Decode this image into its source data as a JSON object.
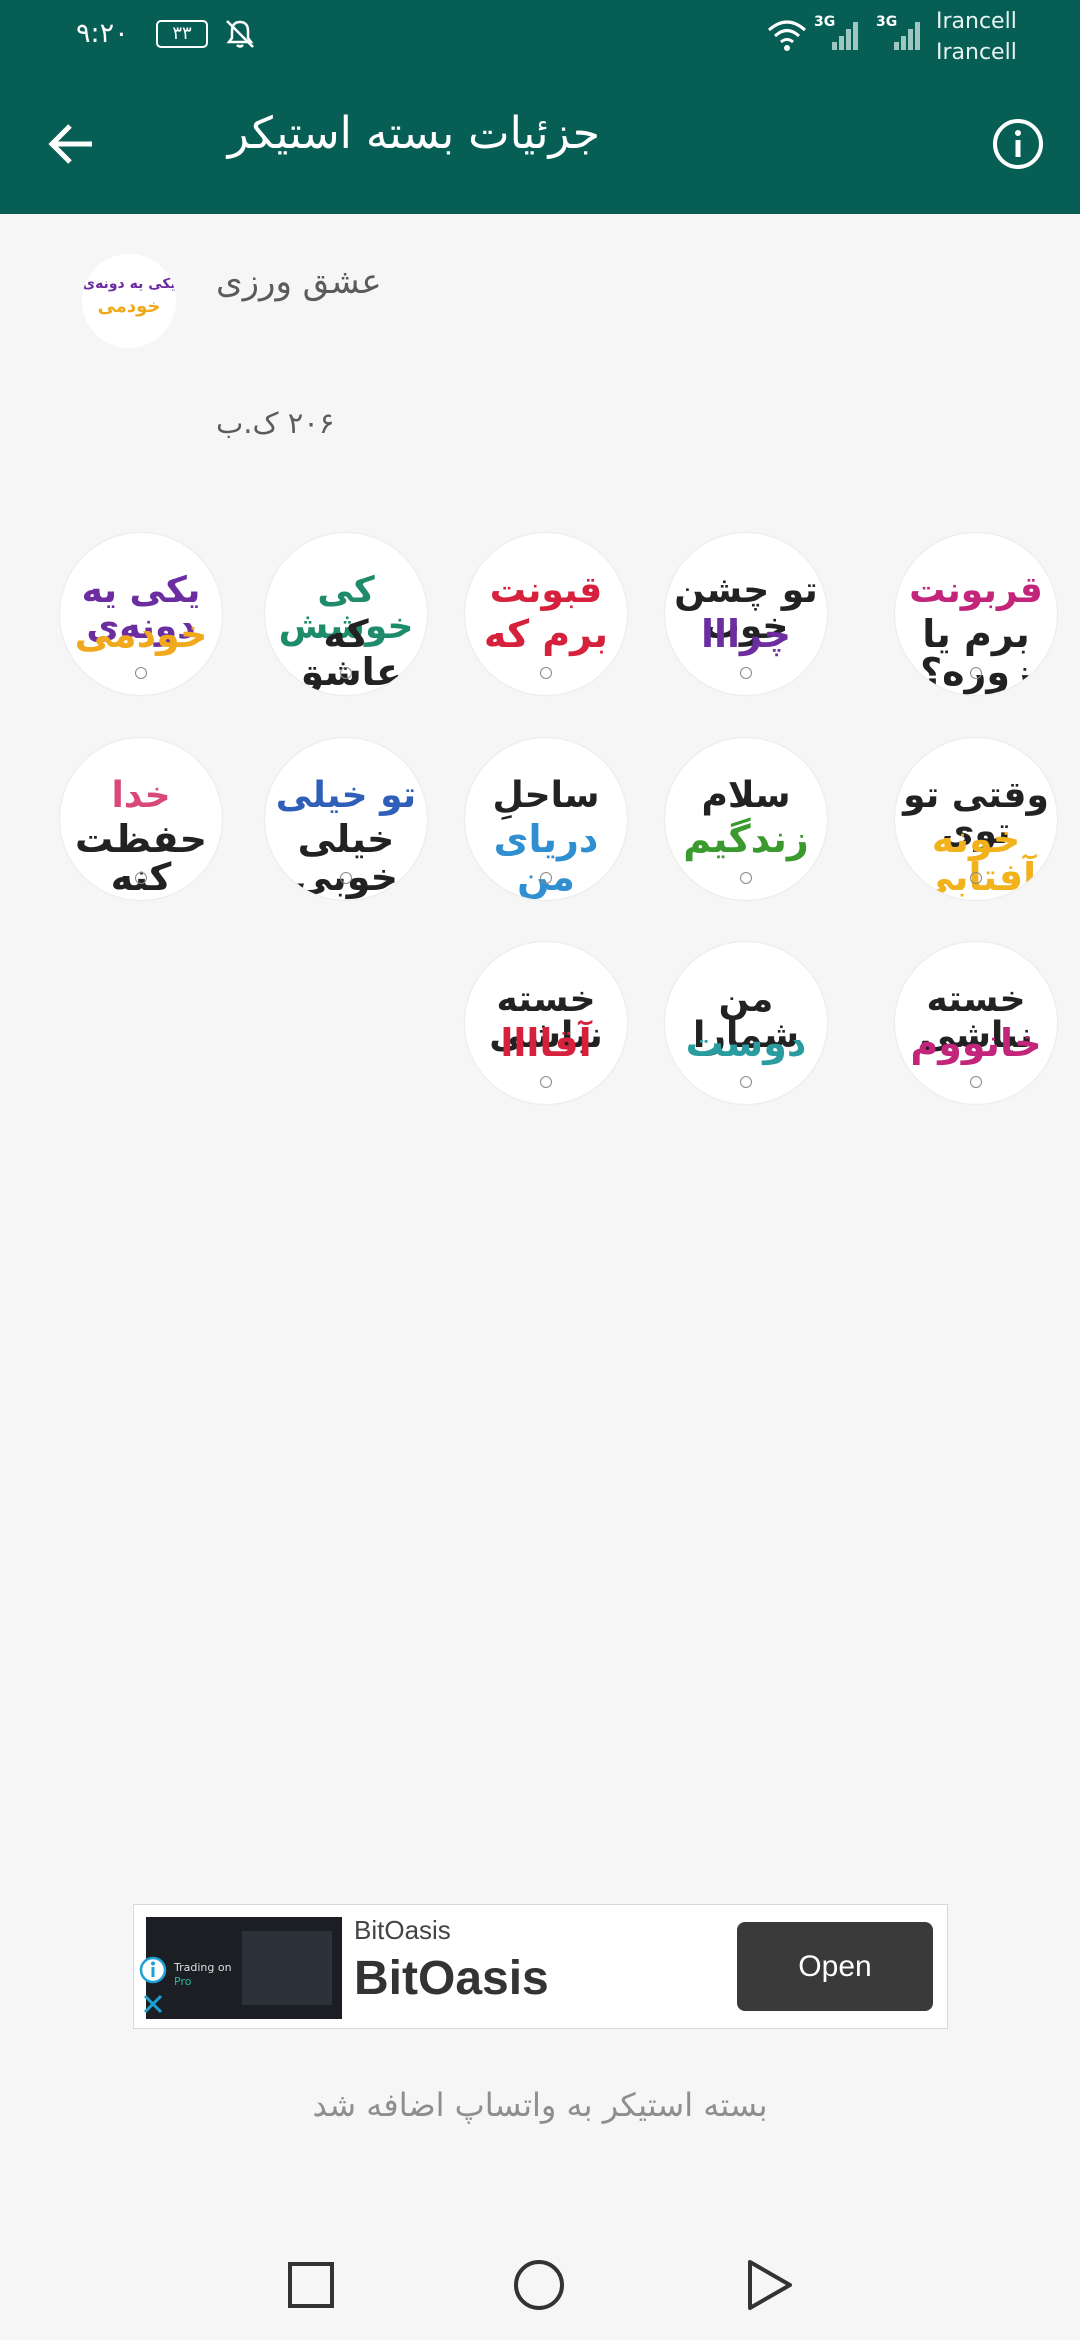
{
  "status_bar": {
    "time": "۹:۲۰",
    "battery": "۳۳",
    "network_type": "3G",
    "carriers": [
      "Irancell",
      "Irancell"
    ]
  },
  "app_bar": {
    "title": "جزئیات بسته استیکر",
    "back_icon": "arrow-left-icon",
    "info_icon": "info-circle-icon",
    "background_color": "#075e54"
  },
  "pack": {
    "name": "عشق ورزی",
    "size": "۲۰۶ ک.ب",
    "icon_text": [
      "یکی یه دونه‌ی",
      "خودمی"
    ]
  },
  "stickers": [
    {
      "lines": [
        "قربونت",
        "برم یا زوره؟"
      ],
      "colors": [
        "#c2257a",
        "#222222"
      ]
    },
    {
      "lines": [
        "تو چشن خوب",
        "چرااا"
      ],
      "colors": [
        "#222222",
        "#6b2da0"
      ]
    },
    {
      "lines": [
        "قبونت",
        "برم که"
      ],
      "colors": [
        "#d6213c",
        "#d6213c"
      ]
    },
    {
      "lines": [
        "کی خوشش",
        "که عاشق شدم؟"
      ],
      "colors": [
        "#1e8b6a",
        "#222222"
      ]
    },
    {
      "lines": [
        "یکی یه دونه‌ی",
        "خودمی"
      ],
      "colors": [
        "#6b2da0",
        "#f0a91c"
      ]
    },
    {
      "lines": [
        "وقتی تو توی",
        "خونه آفتابی میش"
      ],
      "colors": [
        "#222222",
        "#f2b21c"
      ]
    },
    {
      "lines": [
        "سلام",
        "زندگیم"
      ],
      "colors": [
        "#222222",
        "#3a9a2e"
      ]
    },
    {
      "lines": [
        "ساحلِ",
        "دریای من"
      ],
      "colors": [
        "#222222",
        "#2f8fd0"
      ]
    },
    {
      "lines": [
        "تو خیلی",
        "خیلی خوبی"
      ],
      "colors": [
        "#2f5fb8",
        "#222222"
      ]
    },
    {
      "lines": [
        "خدا",
        "حفظت کنه واسم"
      ],
      "colors": [
        "#d9487a",
        "#222222"
      ]
    },
    {
      "lines": [
        "خسته نباشی",
        "خانووم"
      ],
      "colors": [
        "#222222",
        "#c2257a"
      ]
    },
    {
      "lines": [
        "من شمارا",
        "دوست"
      ],
      "colors": [
        "#222222",
        "#2a9ca0"
      ]
    },
    {
      "lines": [
        "خسته نباشی",
        "آقاااا"
      ],
      "colors": [
        "#222222",
        "#d6213c"
      ]
    }
  ],
  "ad": {
    "advertiser": "BitOasis",
    "headline": "BitOasis",
    "cta": "Open",
    "thumb_text": [
      "Trading on",
      "Pro"
    ]
  },
  "footer_status": "بسته استیکر به واتساپ اضافه شد",
  "nav_bar": {
    "icons": [
      "recent-apps-icon",
      "home-icon",
      "back-icon"
    ]
  }
}
